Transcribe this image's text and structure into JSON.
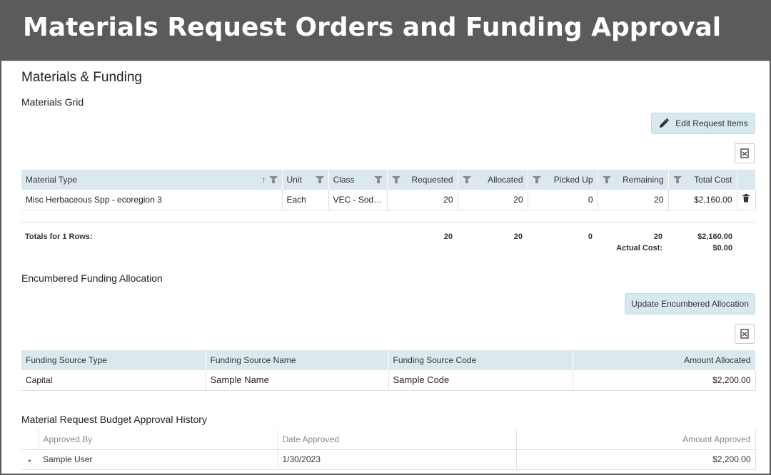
{
  "banner": {
    "title": "Materials Request Orders and Funding Approval"
  },
  "section": {
    "title": "Materials & Funding",
    "materials_grid_label": "Materials Grid",
    "edit_button_label": "Edit Request Items",
    "materials_table": {
      "headers": [
        "Material Type",
        "Unit",
        "Class",
        "Requested",
        "Allocated",
        "Picked Up",
        "Remaining",
        "Total Cost"
      ],
      "rows": [
        {
          "material_type": "Misc Herbaceous Spp - ecoregion 3",
          "unit": "Each",
          "class": "VEC - Sod ...",
          "requested": "20",
          "allocated": "20",
          "picked_up": "0",
          "remaining": "20",
          "total_cost": "$2,160.00"
        }
      ],
      "totals": {
        "label": "Totals for 1 Rows:",
        "requested": "20",
        "allocated": "20",
        "picked_up": "0",
        "remaining": "20",
        "total_cost": "$2,160.00",
        "actual_cost_label": "Actual Cost:",
        "actual_cost": "$0.00"
      }
    },
    "funding_label": "Encumbered Funding Allocation",
    "update_button_label": "Update Encumbered Allocation",
    "funding_table": {
      "headers": [
        "Funding Source Type",
        "Funding Source Name",
        "Funding Source Code",
        "Amount Allocated"
      ],
      "rows": [
        {
          "type": "Capital",
          "name": "Sample Name",
          "code": "Sample Code",
          "amount": "$2,200.00"
        }
      ]
    },
    "history_label": "Material Request Budget Approval History",
    "history_table": {
      "headers": [
        "Approved By",
        "Date Approved",
        "Amount Approved"
      ],
      "rows": [
        {
          "approved_by": "Sample User",
          "date": "1/30/2023",
          "amount": "$2,200.00"
        }
      ]
    }
  },
  "icons": {
    "edit": "pencil-icon",
    "export": "excel-export-icon",
    "delete": "trash-icon",
    "sort": "sort-arrow-icon",
    "filter": "filter-icon",
    "expand": "expand-caret-icon"
  },
  "colors": {
    "banner": "#5b5b5b",
    "header_bg": "#dbe9ef",
    "button_bg": "#d7e8ef"
  }
}
